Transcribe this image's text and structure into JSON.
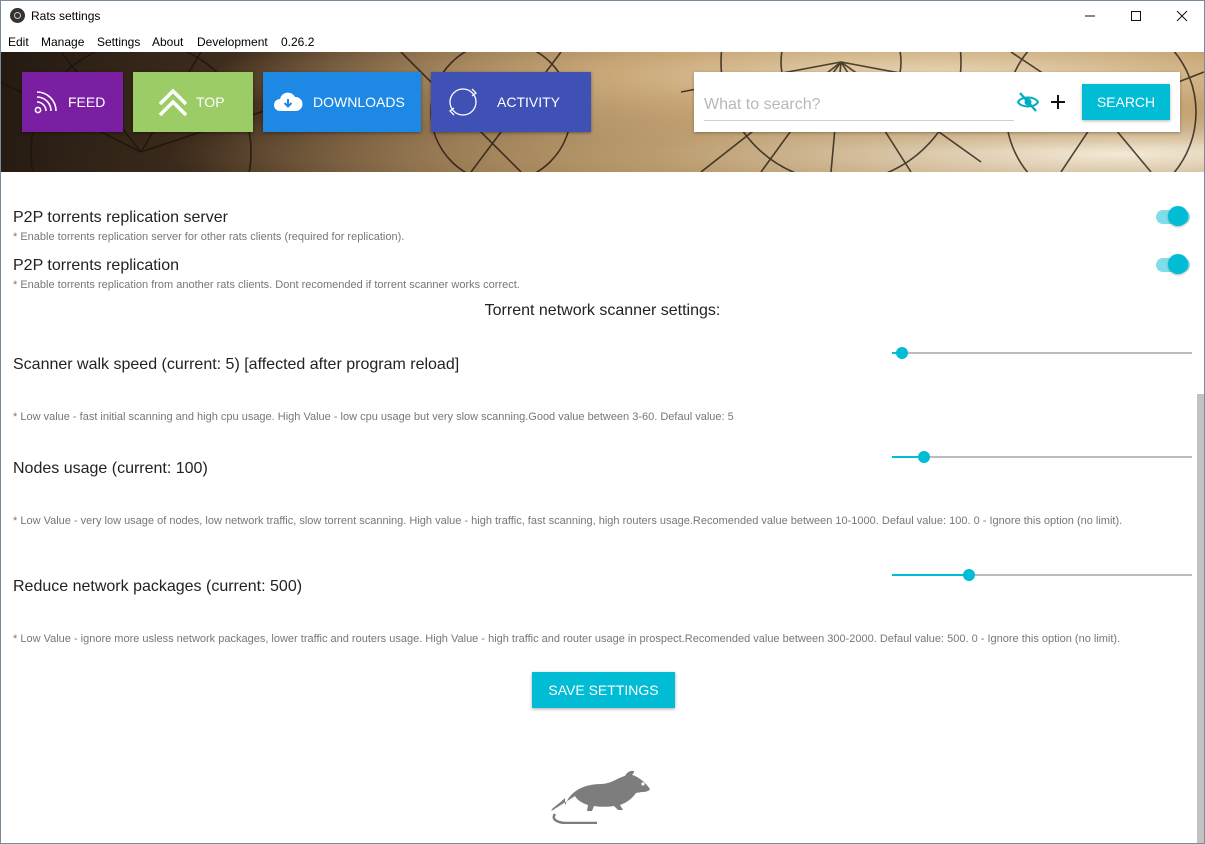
{
  "window": {
    "title": "Rats settings",
    "controls": {
      "minimize": "—",
      "maximize": "☐",
      "close": "✕"
    }
  },
  "menu": {
    "items": [
      "Edit",
      "Manage",
      "Settings",
      "About",
      "Development",
      "0.26.2"
    ]
  },
  "nav": {
    "feed": {
      "label": "FEED",
      "color": "#7b1fa2",
      "icon": "rss-icon"
    },
    "top": {
      "label": "TOP",
      "color": "#9ccc65",
      "icon": "double-chevron-up-icon"
    },
    "downloads": {
      "label": "DOWNLOADS",
      "color": "#1e88e5",
      "icon": "cloud-download-icon"
    },
    "activity": {
      "label": "ACTIVITY",
      "color": "#3f51b5",
      "icon": "refresh-icon"
    }
  },
  "search": {
    "placeholder": "What to search?",
    "value": "",
    "button_label": "SEARCH",
    "accent": "#00bcd4",
    "icons": [
      "eye-off-icon",
      "plus-icon"
    ]
  },
  "settings": {
    "p2p_server": {
      "title": "P2P torrents replication server",
      "hint": "* Enable torrents replication server for other rats clients (required for replication).",
      "enabled": true
    },
    "p2p_replication": {
      "title": "P2P torrents replication",
      "hint": "* Enable torrents replication from another rats clients. Dont recomended if torrent scanner works correct.",
      "enabled": true
    },
    "scanner_section_title": "Torrent network scanner settings:",
    "walk_speed": {
      "title": "Scanner walk speed (current: 5) [affected after program reload]",
      "hint": "* Low value - fast initial scanning and high cpu usage. High Value - low cpu usage but very slow scanning.Good value between 3-60. Defaul value: 5",
      "fraction": 0.027
    },
    "nodes_usage": {
      "title": "Nodes usage (current: 100)",
      "hint": "* Low Value - very low usage of nodes, low network traffic, slow torrent scanning. High value - high traffic, fast scanning, high routers usage.Recomended value between 10-1000. Defaul value: 100. 0 - Ignore this option (no limit).",
      "fraction": 0.1
    },
    "network_packages": {
      "title": "Reduce network packages (current: 500)",
      "hint": "* Low Value - ignore more usless network packages, lower traffic and routers usage. High Value - high traffic and router usage in prospect.Recomended value between 300-2000. Defaul value: 500. 0 - Ignore this option (no limit).",
      "fraction": 0.25
    },
    "save_label": "SAVE SETTINGS"
  },
  "footer": {
    "logo_icon": "rat-logo-icon"
  }
}
